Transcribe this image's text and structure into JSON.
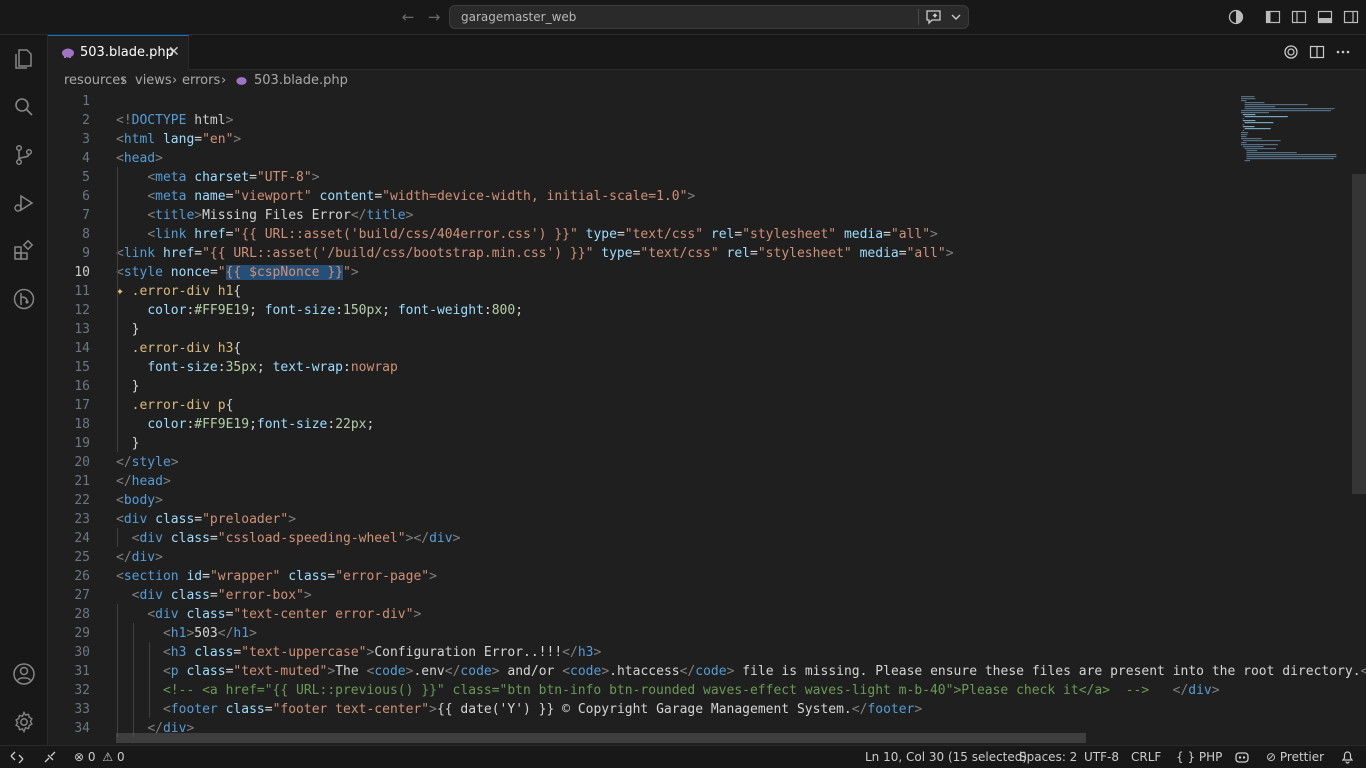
{
  "titlebar": {
    "project": "garagemaster_web"
  },
  "tab": {
    "filename": "503.blade.php",
    "close": "✕"
  },
  "breadcrumb": {
    "parts": [
      "resources",
      "views",
      "errors",
      "503.blade.php"
    ],
    "separator": "›"
  },
  "editor": {
    "line_numbers": [
      "1",
      "2",
      "3",
      "4",
      "5",
      "6",
      "7",
      "8",
      "9",
      "10",
      "11",
      "12",
      "13",
      "14",
      "15",
      "16",
      "17",
      "18",
      "19",
      "20",
      "21",
      "22",
      "23",
      "24",
      "25",
      "26",
      "27",
      "28",
      "29",
      "30",
      "31",
      "32",
      "33",
      "34"
    ],
    "active_line": "10",
    "lines": [
      "",
      "<!DOCTYPE html>",
      "<html lang=\"en\">",
      "<head>",
      "    <meta charset=\"UTF-8\">",
      "    <meta name=\"viewport\" content=\"width=device-width, initial-scale=1.0\">",
      "    <title>Missing Files Error</title>",
      "    <link href=\"{{ URL::asset('build/css/404error.css') }}\" type=\"text/css\" rel=\"stylesheet\" media=\"all\">",
      "<link href=\"{{ URL::asset('/build/css/bootstrap.min.css') }}\" type=\"text/css\" rel=\"stylesheet\" media=\"all\">",
      "<style nonce=\"{{ $cspNonce }}\">",
      "  .error-div h1{",
      "    color:#FF9E19; font-size:150px; font-weight:800;",
      "  }",
      "  .error-div h3{",
      "    font-size:35px; text-wrap:nowrap",
      "  }",
      "  .error-div p{",
      "    color:#FF9E19;font-size:22px;",
      "  }",
      "</style>",
      "</head>",
      "<body>",
      "<div class=\"preloader\">",
      "  <div class=\"cssload-speeding-wheel\"></div>",
      "</div>",
      "<section id=\"wrapper\" class=\"error-page\">",
      "  <div class=\"error-box\">",
      "    <div class=\"text-center error-div\">",
      "      <h1>503</h1>",
      "      <h3 class=\"text-uppercase\">Configuration Error..!!!</h3>",
      "      <p class=\"text-muted\">The <code>.env</code> and/or <code>.htaccess</code> file is missing. Please ensure these files are present into the root directory.</",
      "      <!-- <a href=\"{{ URL::previous() }}\" class=\"btn btn-info btn-rounded waves-effect waves-light m-b-40\">Please check it</a>  -->   </div>",
      "      <footer class=\"footer text-center\">{{ date('Y') }} © Copyright Garage Management System.</footer>",
      "    </div>"
    ]
  },
  "statusbar": {
    "errors": "0",
    "warnings": "0",
    "position": "Ln 10, Col 30 (15 selected)",
    "spaces": "Spaces: 2",
    "encoding": "UTF-8",
    "eol": "CRLF",
    "language": "PHP",
    "language_icon": "{ }",
    "formatter": "Prettier"
  },
  "colors": {
    "accent": "#0078d4",
    "background": "#1f1f1f",
    "chrome": "#181818"
  },
  "icons": [
    "explorer-icon",
    "search-icon",
    "source-control-icon",
    "run-debug-icon",
    "extensions-icon",
    "git-graph-icon",
    "account-icon",
    "settings-gear-icon",
    "copilot-icon",
    "split-editor-icon",
    "more-actions-icon",
    "remote-icon",
    "bell-icon"
  ]
}
